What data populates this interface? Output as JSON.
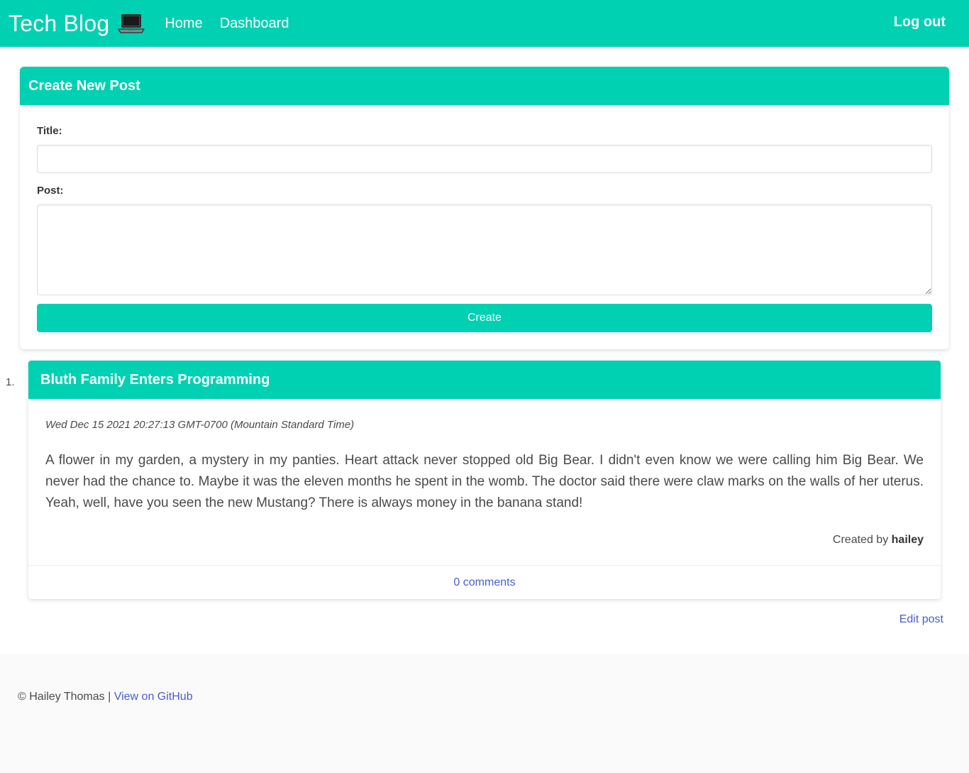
{
  "nav": {
    "brand": "Tech Blog",
    "brand_icon": "laptop-icon",
    "links": [
      "Home",
      "Dashboard"
    ],
    "logout_label": "Log out",
    "accent_color": "#00d1b2"
  },
  "create_post": {
    "header": "Create New Post",
    "title_label": "Title:",
    "title_value": "",
    "post_label": "Post:",
    "post_value": "",
    "button_label": "Create"
  },
  "posts": [
    {
      "number": "1.",
      "title": "Bluth Family Enters Programming",
      "date": "Wed Dec 15 2021 20:27:13 GMT-0700 (Mountain Standard Time)",
      "body": "A flower in my garden, a mystery in my panties. Heart attack never stopped old Big Bear. I didn't even know we were calling him Big Bear. We never had the chance to. Maybe it was the eleven months he spent in the womb. The doctor said there were claw marks on the walls of her uterus. Yeah, well, have you seen the new Mustang? There is always money in the banana stand!",
      "created_by_prefix": "Created by",
      "author": "hailey",
      "comments_label": "0 comments",
      "edit_label": "Edit post"
    }
  ],
  "footer": {
    "copyright": "© Hailey Thomas",
    "separator": "|",
    "github_label": "View on GitHub",
    "link_color": "#485fc7"
  }
}
